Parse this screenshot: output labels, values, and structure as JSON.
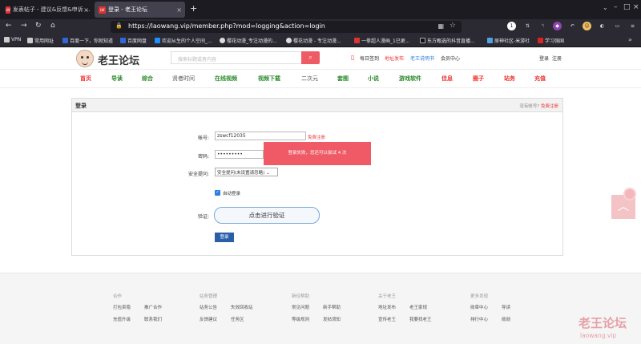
{
  "browser": {
    "tabs": [
      {
        "favicon": "LW",
        "title": "发表帖子 - 建议&反馈&申诉 ..."
      },
      {
        "favicon": "LW",
        "title": "登录 - 老王论坛"
      }
    ],
    "new_tab": "+",
    "url": "https://laowang.vip/member.php?mod=logging&action=login",
    "bookmarks": [
      "VPN",
      "常用网址",
      "百度一下，你就知道",
      "百度网盘",
      "欢迎从生的个人空间_...",
      "樱花动漫_专注动漫的...",
      "樱花动漫 - 专注动漫...",
      "一拳超人漫画_1已更...",
      "东方甄选的抖音直播...",
      "原神社区-米游社",
      "学习强国"
    ]
  },
  "site": {
    "logo_text": "老王论坛",
    "search_placeholder": "搜索标题或者内容",
    "header_links": {
      "signin": "每日签到",
      "publish": "地址发布",
      "app": "老王说明书",
      "user_center": "会员中心",
      "login": "登录",
      "register": "注册"
    },
    "nav": [
      "首页",
      "导读",
      "综合",
      "贤者时间",
      "在线视频",
      "视频下载",
      "二次元",
      "套图",
      "小说",
      "游戏软件",
      "佳息",
      "圈子",
      "站务",
      "充值"
    ]
  },
  "login": {
    "title": "登录",
    "no_account": "没有帐号?",
    "register_link": "免费注册",
    "username_label": "帐号:",
    "username_value": "zswcf12035",
    "username_hint": "免费注册",
    "password_label": "密码:",
    "password_value": "•••••••••",
    "question_label": "安全提问:",
    "question_value": "安全提问(未设置请忽略)",
    "auto_login": "自动登录",
    "verify_label": "验证:",
    "verify_button": "点击进行验证",
    "submit": "登录",
    "toast": "登录失败，您还可以尝试 4 次"
  },
  "footer": {
    "columns": [
      {
        "title": "合作",
        "links": [
          "打包卖隐",
          "推广合作",
          "充值升级",
          "联系我们"
        ]
      },
      {
        "title": "站务管理",
        "links": [
          "站务公告",
          "失效回收站",
          "反馈建议",
          "任务区"
        ]
      },
      {
        "title": "新径帮助",
        "links": [
          "常见问题",
          "新手帮助",
          "等级规则",
          "发帖须知"
        ]
      },
      {
        "title": "关于老王",
        "links": [
          "地址发布",
          "老王家规",
          "宣传老王",
          "我要找老王"
        ]
      },
      {
        "title": "更多发现",
        "links": [
          "勋章中心",
          "导读",
          "排行中心",
          "勋勋"
        ]
      }
    ],
    "watermark": "老王论坛",
    "watermark_url": "laowang.vip"
  }
}
